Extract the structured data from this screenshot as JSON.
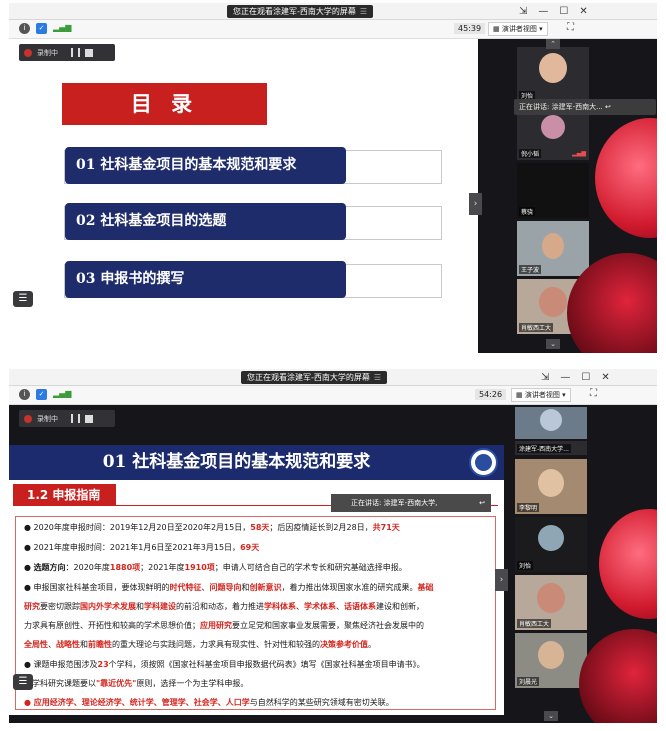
{
  "screen1": {
    "title_bar": "您正在观看涂建军-西南大学的屏幕",
    "title_icon": "☰",
    "timer": "45:39",
    "view_button": "演讲者视图",
    "recording": "录制中",
    "speaking_label": "正在讲话: 涂建军-西南大...",
    "participants": [
      "刘怡",
      "倪小韬",
      "蔡骁",
      "王子波",
      "肖敏西工大"
    ],
    "slide": {
      "title": "目 录",
      "items": [
        "01 社科基金项目的基本规范和要求",
        "02 社科基金项目的选题",
        "03 申报书的撰写"
      ]
    }
  },
  "screen2": {
    "title_bar": "您正在观看涂建军-西南大学的屏幕",
    "title_icon": "☰",
    "timer": "54:26",
    "view_button": "演讲者视图",
    "recording": "录制中",
    "speaking_label": "正在讲话: 涂建军-西南大学,",
    "top_participant": "涂建军-西南大学...",
    "participants": [
      "李黎明",
      "刘怡",
      "肖敏西工大",
      "刘晨光"
    ],
    "slide": {
      "title": "01 社科基金项目的基本规范和要求",
      "subtitle": "1.2 申报指南",
      "l1a": "2020年度申报时间：2019年12月20日至2020年2月15日，",
      "l1b": "58天",
      "l1c": "；后因疫情延长到2月28日，",
      "l1d": "共71天",
      "l2a": "2021年度申报时间：2021年1月6日至2021年3月15日，",
      "l2b": "69天",
      "l3a": "选题方向",
      "l3b": "：2020年度",
      "l3c": "1880项",
      "l3d": "；2021年度",
      "l3e": "1910项",
      "l3f": "；申请人可结合自己的学术专长和研究基础选择申报。",
      "l4a": "申报国家社科基金项目，要体现鲜明的",
      "l4b": "时代特征",
      "l4c": "、",
      "l4d": "问题导向",
      "l4e": "和",
      "l4f": "创新意识",
      "l4g": "，着力推出体现国家水准的研究成果。",
      "l4h": "基础",
      "l5a": "研究",
      "l5b": "要密切跟踪",
      "l5c": "国内外学术发展",
      "l5d": "和",
      "l5e": "学科建设",
      "l5f": "的前沿和动态，着力推进",
      "l5g": "学科体系",
      "l5h": "、",
      "l5i": "学术体系",
      "l5j": "、",
      "l5k": "话语体系",
      "l5l": "建设和创新，",
      "l6a": "力求具有原创性、开拓性和较高的学术思想价值；",
      "l6b": "应用研究",
      "l6c": "要立足党和国家事业发展需要，聚焦经济社会发展中的",
      "l7a": "全局性",
      "l7b": "、",
      "l7c": "战略性",
      "l7d": "和",
      "l7e": "前瞻性",
      "l7f": "的重大理论与实践问题，力求具有现实性、针对性和较强的",
      "l7g": "决策参考价值",
      "l7h": "。",
      "l8a": "课题申报范围涉及",
      "l8b": "23",
      "l8c": "个学科，须按照《国家社科基金项目申报数据代码表》填写《国家社科基金项目申请书》。",
      "l9a": "跨学科研究课题要以",
      "l9b": "\"靠近优先\"",
      "l9c": "原则，选择一个为主学科申报。",
      "l10a": "应用经济学、理论经济学、统计学、管理学、社会学、人口学",
      "l10b": "与自然科学的某些研究领域有密切关联。"
    }
  }
}
